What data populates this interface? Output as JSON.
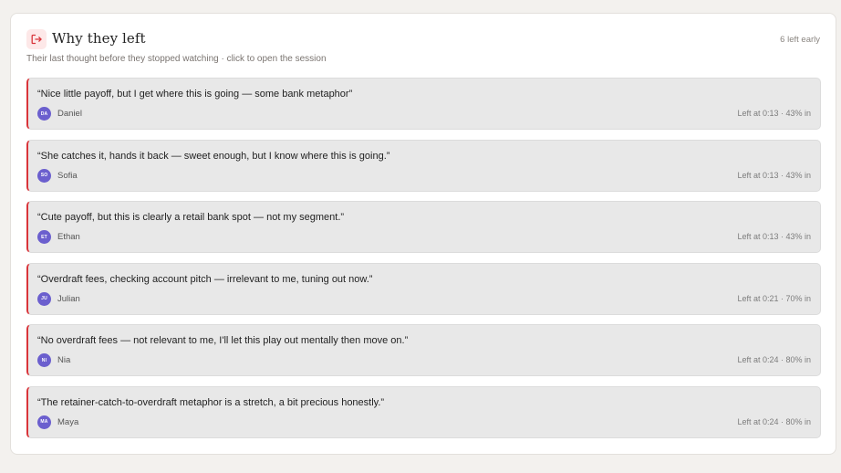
{
  "panel": {
    "title": "Why they left",
    "subtitle": "Their last thought before they stopped watching · click to open the session",
    "count_label": "6 left early",
    "icon": "exit-icon",
    "accent_color": "#d9343a",
    "avatar_color": "#6b5fce"
  },
  "sessions": [
    {
      "quote": "“Nice little payoff, but I get where this is going — some bank metaphor”",
      "initials": "DA",
      "name": "Daniel",
      "meta": "Left at 0:13 · 43% in"
    },
    {
      "quote": "“She catches it, hands it back — sweet enough, but I know where this is going.”",
      "initials": "SO",
      "name": "Sofia",
      "meta": "Left at 0:13 · 43% in"
    },
    {
      "quote": "“Cute payoff, but this is clearly a retail bank spot — not my segment.”",
      "initials": "ET",
      "name": "Ethan",
      "meta": "Left at 0:13 · 43% in"
    },
    {
      "quote": "“Overdraft fees, checking account pitch — irrelevant to me, tuning out now.”",
      "initials": "JU",
      "name": "Julian",
      "meta": "Left at 0:21 · 70% in"
    },
    {
      "quote": "“No overdraft fees — not relevant to me, I'll let this play out mentally then move on.”",
      "initials": "NI",
      "name": "Nia",
      "meta": "Left at 0:24 · 80% in"
    },
    {
      "quote": "“The retainer-catch-to-overdraft metaphor is a stretch, a bit precious honestly.”",
      "initials": "MA",
      "name": "Maya",
      "meta": "Left at 0:24 · 80% in"
    }
  ]
}
